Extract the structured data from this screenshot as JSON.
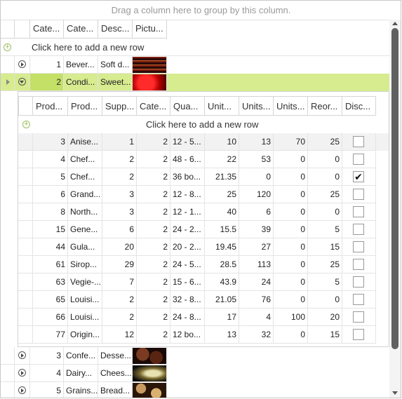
{
  "group_panel_text": "Drag a column here to group by this column.",
  "master": {
    "columns": [
      "Cate...",
      "Cate...",
      "Desc...",
      "Pictu..."
    ],
    "add_row_text": "Click here to add a new row",
    "rows": [
      {
        "id": "1",
        "name": "Bever...",
        "desc": "Soft d...",
        "picture": "beverages-image",
        "selected": false
      },
      {
        "id": "2",
        "name": "Condi...",
        "desc": "Sweet...",
        "picture": "condiments-image",
        "selected": true
      },
      {
        "id": "3",
        "name": "Confe...",
        "desc": "Desse...",
        "picture": "confections-image",
        "selected": false
      },
      {
        "id": "4",
        "name": "Dairy...",
        "desc": "Chees...",
        "picture": "dairy-image",
        "selected": false
      },
      {
        "id": "5",
        "name": "Grains...",
        "desc": "Bread...",
        "picture": "grains-image",
        "selected": false
      }
    ]
  },
  "child": {
    "columns": [
      "Prod...",
      "Prod...",
      "Supp...",
      "Cate...",
      "Qua...",
      "Unit...",
      "Units...",
      "Units...",
      "Reor...",
      "Disc..."
    ],
    "add_row_text": "Click here to add a new row",
    "rows": [
      [
        "3",
        "Anise...",
        "1",
        "2",
        "12 - 5...",
        "10",
        "13",
        "70",
        "25",
        false
      ],
      [
        "4",
        "Chef...",
        "2",
        "2",
        "48 - 6...",
        "22",
        "53",
        "0",
        "0",
        false
      ],
      [
        "5",
        "Chef...",
        "2",
        "2",
        "36 bo...",
        "21.35",
        "0",
        "0",
        "0",
        true
      ],
      [
        "6",
        "Grand...",
        "3",
        "2",
        "12 - 8...",
        "25",
        "120",
        "0",
        "25",
        false
      ],
      [
        "8",
        "North...",
        "3",
        "2",
        "12 - 1...",
        "40",
        "6",
        "0",
        "0",
        false
      ],
      [
        "15",
        "Gene...",
        "6",
        "2",
        "24 - 2...",
        "15.5",
        "39",
        "0",
        "5",
        false
      ],
      [
        "44",
        "Gula...",
        "20",
        "2",
        "20 - 2...",
        "19.45",
        "27",
        "0",
        "15",
        false
      ],
      [
        "61",
        "Sirop...",
        "29",
        "2",
        "24 - 5...",
        "28.5",
        "113",
        "0",
        "25",
        false
      ],
      [
        "63",
        "Vegie-...",
        "7",
        "2",
        "15 - 6...",
        "43.9",
        "24",
        "0",
        "5",
        false
      ],
      [
        "65",
        "Louisi...",
        "2",
        "2",
        "32 - 8...",
        "21.05",
        "76",
        "0",
        "0",
        false
      ],
      [
        "66",
        "Louisi...",
        "2",
        "2",
        "24 - 8...",
        "17",
        "4",
        "100",
        "20",
        false
      ],
      [
        "77",
        "Origin...",
        "12",
        "2",
        "12 bo...",
        "13",
        "32",
        "0",
        "15",
        false
      ]
    ]
  },
  "colors": {
    "selected_row": "#d7eb8f",
    "selected_cell": "#c4e066",
    "add_icon": "#9dbb5e"
  }
}
